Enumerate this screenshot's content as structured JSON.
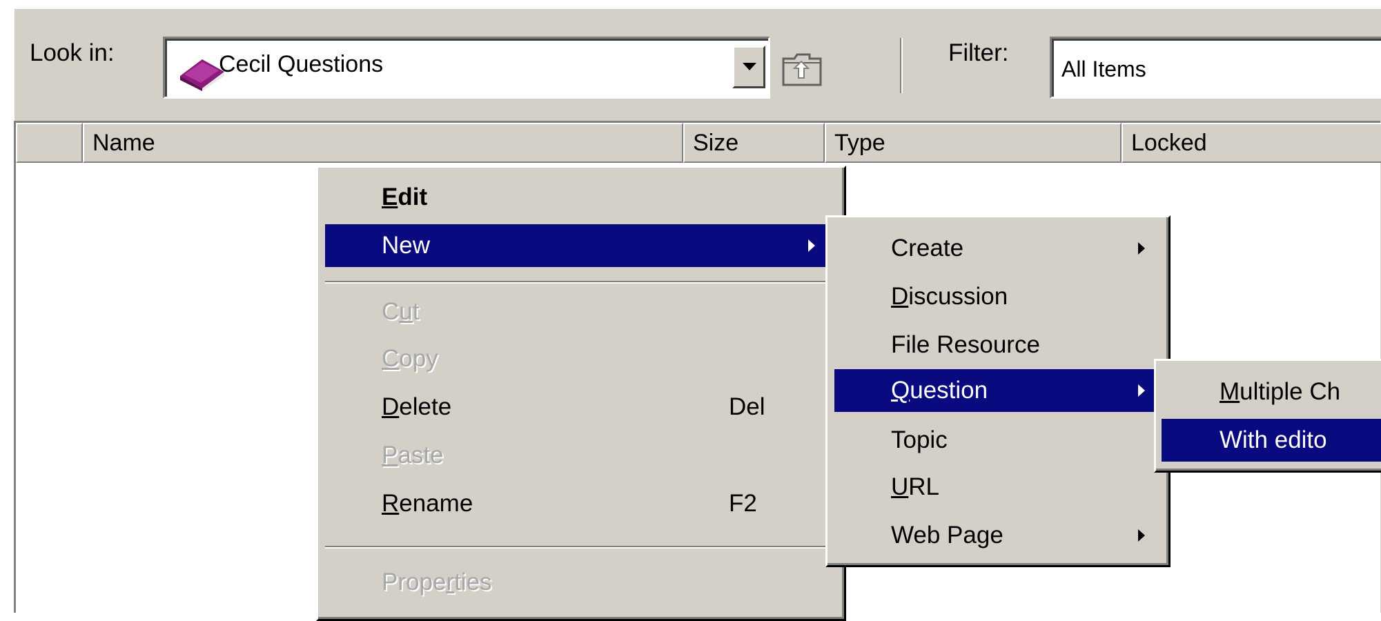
{
  "toolbar": {
    "look_in_label": "Look in:",
    "look_in_value": "Cecil Questions",
    "filter_label": "Filter:",
    "filter_value": "All Items"
  },
  "columns": [
    "Name",
    "Size",
    "Type",
    "Locked"
  ],
  "context_menu": {
    "items": [
      {
        "label": "Edit",
        "state": "bold"
      },
      {
        "label": "New",
        "state": "highlighted",
        "submenu": true
      },
      {
        "label": "Cut",
        "state": "disabled"
      },
      {
        "label": "Copy",
        "state": "disabled"
      },
      {
        "label": "Delete",
        "shortcut": "Del"
      },
      {
        "label": "Paste",
        "state": "disabled"
      },
      {
        "label": "Rename",
        "shortcut": "F2"
      },
      {
        "label": "Properties",
        "state": "disabled"
      }
    ]
  },
  "new_submenu": {
    "items": [
      {
        "label": "Create",
        "submenu": true
      },
      {
        "label": "Discussion"
      },
      {
        "label": "File Resource"
      },
      {
        "label": "Question",
        "state": "highlighted",
        "submenu": true
      },
      {
        "label": "Topic"
      },
      {
        "label": "URL"
      },
      {
        "label": "Web Page",
        "submenu": true
      }
    ]
  },
  "question_submenu": {
    "items": [
      {
        "label": "Multiple Ch"
      },
      {
        "label": "With edito",
        "state": "highlighted"
      }
    ]
  },
  "colors": {
    "face": "#d4d0c8",
    "highlight": "#0a0a80",
    "disabled_text": "#a8a8a8",
    "book_icon": "#8b1a7a"
  }
}
